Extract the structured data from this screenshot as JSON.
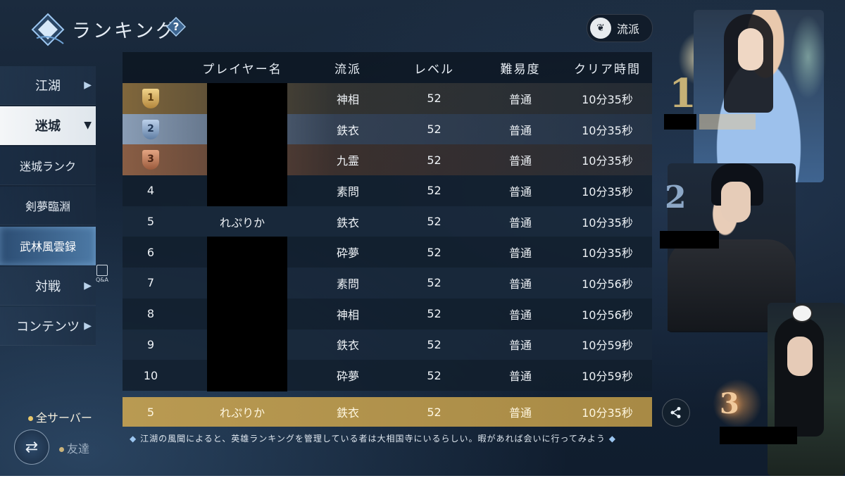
{
  "header": {
    "title": "ランキング",
    "help_icon": "question-icon",
    "school_filter_label": "流派"
  },
  "sidebar": {
    "items": [
      {
        "label": "江湖",
        "icon": "chevron-right-icon"
      },
      {
        "label": "迷城",
        "icon": "chevron-down-icon",
        "active": true
      },
      {
        "label": "迷城ランク"
      },
      {
        "label": "剣夢臨淵"
      },
      {
        "label": "武林風雲録",
        "selected": true
      },
      {
        "label": "対戦",
        "icon": "chevron-right-icon"
      },
      {
        "label": "コンテンツ",
        "icon": "chevron-right-icon"
      }
    ],
    "qa_label": "Q&A"
  },
  "server": {
    "all_label": "全サーバー",
    "friend_label": "友達"
  },
  "table": {
    "headers": [
      "",
      "プレイヤー名",
      "流派",
      "レベル",
      "難易度",
      "クリア時間"
    ],
    "rows": [
      {
        "rank": "1",
        "name": "",
        "school": "神相",
        "level": "52",
        "difficulty": "普通",
        "time": "10分35秒"
      },
      {
        "rank": "2",
        "name": "",
        "school": "鉄衣",
        "level": "52",
        "difficulty": "普通",
        "time": "10分35秒"
      },
      {
        "rank": "3",
        "name": "",
        "school": "九霊",
        "level": "52",
        "difficulty": "普通",
        "time": "10分35秒"
      },
      {
        "rank": "4",
        "name": "",
        "school": "素問",
        "level": "52",
        "difficulty": "普通",
        "time": "10分35秒"
      },
      {
        "rank": "5",
        "name": "れぷりか",
        "school": "鉄衣",
        "level": "52",
        "difficulty": "普通",
        "time": "10分35秒"
      },
      {
        "rank": "6",
        "name": "",
        "school": "砕夢",
        "level": "52",
        "difficulty": "普通",
        "time": "10分35秒"
      },
      {
        "rank": "7",
        "name": "",
        "school": "素問",
        "level": "52",
        "difficulty": "普通",
        "time": "10分56秒"
      },
      {
        "rank": "8",
        "name": "",
        "school": "神相",
        "level": "52",
        "difficulty": "普通",
        "time": "10分56秒"
      },
      {
        "rank": "9",
        "name": "",
        "school": "鉄衣",
        "level": "52",
        "difficulty": "普通",
        "time": "10分59秒"
      },
      {
        "rank": "10",
        "name": "",
        "school": "砕夢",
        "level": "52",
        "difficulty": "普通",
        "time": "10分59秒"
      }
    ],
    "self_row": {
      "rank": "5",
      "name": "れぷりか",
      "school": "鉄衣",
      "level": "52",
      "difficulty": "普通",
      "time": "10分35秒"
    }
  },
  "tip": "江湖の風聞によると、英雄ランキングを管理している者は大相国寺にいるらしい。暇があれば会いに行ってみよう",
  "podium": {
    "first": "1",
    "second": "2",
    "third": "3"
  },
  "colors": {
    "gold": "#b99a52",
    "accent": "#4d7aa6"
  }
}
